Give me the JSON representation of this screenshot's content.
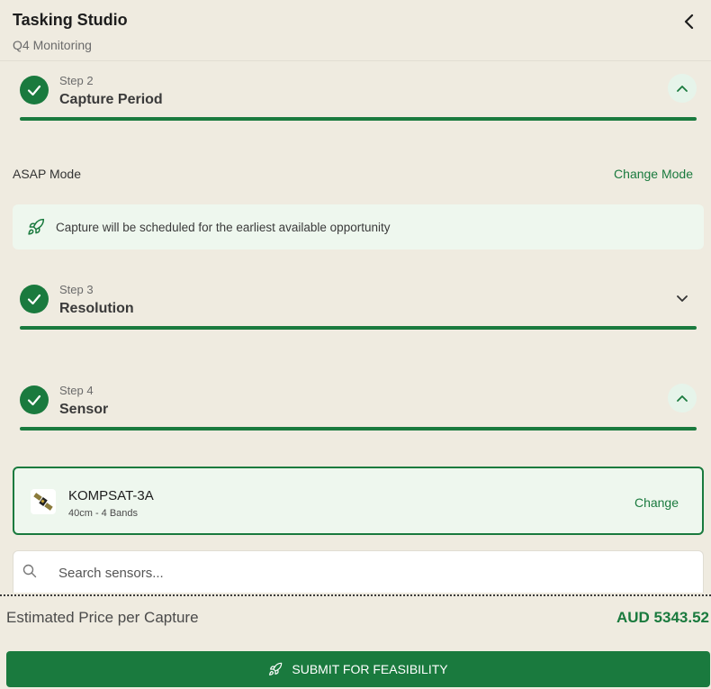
{
  "header": {
    "title": "Tasking Studio",
    "subtitle": "Q4 Monitoring",
    "back_icon": "chevron-left-icon"
  },
  "steps": [
    {
      "number_label": "Step 2",
      "name": "Capture Period",
      "complete": true,
      "expanded": true
    },
    {
      "number_label": "Step 3",
      "name": "Resolution",
      "complete": true,
      "expanded": false
    },
    {
      "number_label": "Step 4",
      "name": "Sensor",
      "complete": true,
      "expanded": true
    }
  ],
  "capture_period": {
    "mode_label": "ASAP Mode",
    "change_mode_label": "Change Mode",
    "info_message": "Capture will be scheduled for the earliest available opportunity",
    "info_icon": "rocket-icon"
  },
  "sensor": {
    "name": "KOMPSAT-3A",
    "spec": "40cm - 4 Bands",
    "change_label": "Change",
    "search_placeholder": "Search sensors..."
  },
  "footer": {
    "price_label": "Estimated Price per Capture",
    "price_value": "AUD 5343.52",
    "submit_label": "SUBMIT FOR FEASIBILITY"
  },
  "colors": {
    "accent": "#1a7a3e",
    "background": "#efebe0",
    "info_bg": "#eef7ee"
  }
}
